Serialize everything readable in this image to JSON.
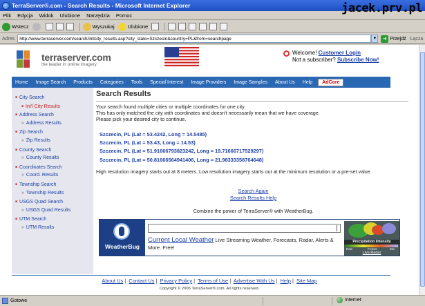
{
  "window": {
    "title": "TerraServer®.com - Search Results - Microsoft Internet Explorer",
    "watermark": "jacek.prv.pl"
  },
  "menubar": [
    "Plik",
    "Edycja",
    "Widok",
    "Ulubione",
    "Narzędzia",
    "Pomoc"
  ],
  "toolbar": {
    "back_label": "Wstecz",
    "search_label": "Wyszukaj",
    "favorites_label": "Ulubione"
  },
  "addressbar": {
    "label": "Adres",
    "url": "http://www.terraserver.com/search/intlcity_results.asp?city_state=Szczecin&country=PL&from=searchpage",
    "go_label": "Przejdź",
    "links_label": "Łącza"
  },
  "header": {
    "logo_text": "terraserver.com",
    "logo_sub": "the leader in online imagery",
    "welcome_text": "Welcome!",
    "login_link": "Customer Login",
    "not_subscriber_text": "Not a subscriber?",
    "subscribe_link": "Subscribe Now!"
  },
  "nav": {
    "items": [
      "Home",
      "Image Search",
      "Products",
      "Categories",
      "Tools",
      "Special Interest",
      "Image Providers",
      "Image Samples",
      "About Us",
      "Help"
    ],
    "adcore_label": "AdCore"
  },
  "sidebar": {
    "items": [
      {
        "label": "City Search",
        "level": 1
      },
      {
        "label": "Int'l City Results",
        "level": 2,
        "active": true
      },
      {
        "label": "Address Search",
        "level": 1
      },
      {
        "label": "Address Results",
        "level": 2
      },
      {
        "label": "Zip Search",
        "level": 1
      },
      {
        "label": "Zip Results",
        "level": 2
      },
      {
        "label": "County Search",
        "level": 1
      },
      {
        "label": "County Results",
        "level": 2
      },
      {
        "label": "Coordinates Search",
        "level": 1
      },
      {
        "label": "Coord. Results",
        "level": 2
      },
      {
        "label": "Township Search",
        "level": 1
      },
      {
        "label": "Township Results",
        "level": 2
      },
      {
        "label": "USGS Quad Search",
        "level": 1
      },
      {
        "label": "USGS Quad Results",
        "level": 2
      },
      {
        "label": "UTM Search",
        "level": 1
      },
      {
        "label": "UTM Results",
        "level": 2
      }
    ]
  },
  "main": {
    "title": "Search Results",
    "intro": [
      "Your search found multiple cities or multiple coordinates for one city.",
      "This has only matched the city with coordinates and doesn't necessarily mean that we have coverage.",
      "Please pick your desired city to continue."
    ],
    "results": [
      "Szczecin, PL (Lat = 53.4242, Long = 14.5485)",
      "Szczecin, PL (Lat = 53.43, Long = 14.53)",
      "Szczecin, PL (Lat = 51.91666793823242, Long = 19.71666717529297)",
      "Szczecin, PL (Lat = 50.81666564941406, Long = 21.98333358764648)"
    ],
    "resolution_note": "High resolution imagery starts out at 8 meters. Low resolution imagery starts out at the minimum resolution or a pre-set value.",
    "search_again": "Search Again",
    "search_results_help": "Search Results Help",
    "combine_text": "Combine the power of TerraServer® with WeatherBug."
  },
  "weatherbug": {
    "logo_text": "WeatherBug",
    "current_local_weather": "Current Local Weather",
    "promo_text": "Live Streaming Weather, Forecasts, Radar, Alerts & More. Free!",
    "map_caption": "Precipitation Intensity",
    "scale_labels": [
      "Rain",
      "Frozen",
      "Mix"
    ],
    "live_radar": "Live Radar"
  },
  "footer": {
    "links": [
      "About Us",
      "Contact Us",
      "Privacy Policy",
      "Terms of Use",
      "Advertise With Us",
      "Help",
      "Site Map"
    ],
    "copyright": "Copyright © 2006 TerraServer®.com. All rights reserved."
  },
  "statusbar": {
    "status": "Gotowe",
    "zone": "Internet"
  }
}
